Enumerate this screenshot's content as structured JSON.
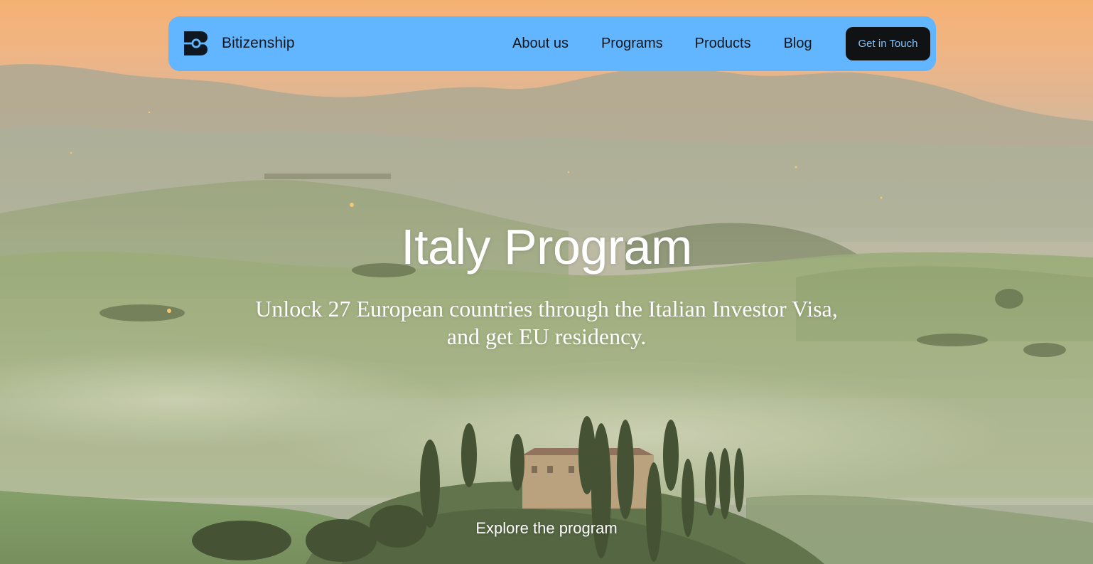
{
  "brand": {
    "name": "Bitizenship",
    "logo_icon": "bitizenship-logo-icon"
  },
  "nav": {
    "links": [
      "About us",
      "Programs",
      "Products",
      "Blog"
    ],
    "cta_label": "Get in Touch"
  },
  "hero": {
    "title": "Italy Program",
    "subtitle_lines": [
      "Unlock 27 European countries through the Italian Investor Visa,",
      "and get EU residency."
    ],
    "explore_label": "Explore the program",
    "background_image": "tuscany-landscape-with-cypress-villa-at-dawn"
  },
  "colors": {
    "nav_background": "#61b6ff",
    "cta_background": "#111214",
    "cta_text": "#7ec4ff",
    "nav_text": "#10161c",
    "hero_text": "#ffffff",
    "sky_top": "#f5b06f"
  }
}
